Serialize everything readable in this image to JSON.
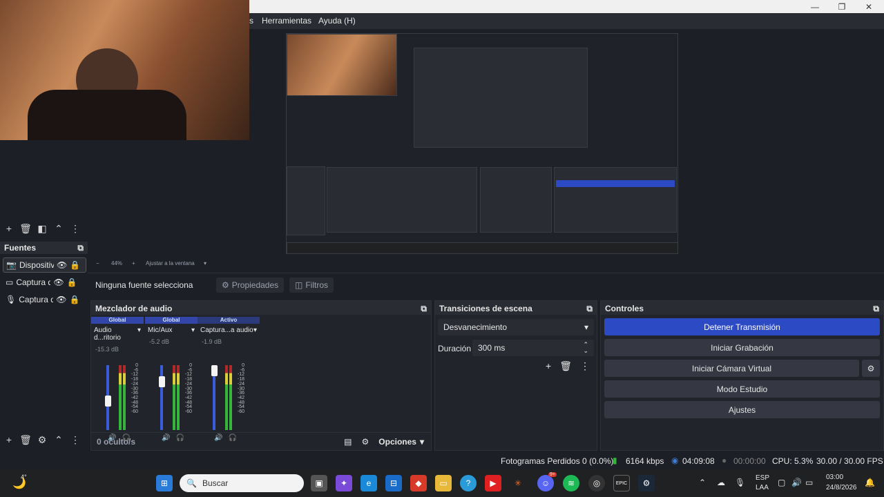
{
  "window": {
    "min": "—",
    "max": "❐",
    "close": "✕"
  },
  "menu": {
    "items": [
      "s",
      "Herramientas",
      "Ayuda (H)"
    ]
  },
  "sources": {
    "title": "Fuentes",
    "items": [
      {
        "label": "Dispositiv",
        "icon": "camera-icon"
      },
      {
        "label": "Captura d",
        "icon": "monitor-icon"
      },
      {
        "label": "Captura d",
        "icon": "mic-icon"
      }
    ]
  },
  "zoom": {
    "minus": "−",
    "value": "44%",
    "plus": "+",
    "fit": "Ajustar a la ventana"
  },
  "source_bar": {
    "none": "Ninguna fuente selecciona",
    "properties": "Propiedades",
    "filters": "Filtros"
  },
  "mixer": {
    "title": "Mezclador de audio",
    "channels": [
      {
        "tag": "Global",
        "name": "Audio d...ritorio",
        "db": "-15.3 dB",
        "level": 0.45
      },
      {
        "tag": "Global",
        "name": "Mic/Aux",
        "db": "-5.2 dB",
        "level": 0.75
      },
      {
        "tag": "Activo",
        "name": "Captura...a audio",
        "db": "-1.9 dB",
        "level": 0.92
      }
    ],
    "scale": [
      "0",
      "-6",
      "-12",
      "-18",
      "-24",
      "-30",
      "-36",
      "-42",
      "-48",
      "-54",
      "-60"
    ],
    "hidden": "0 oculto/s",
    "options": "Opciones"
  },
  "transitions": {
    "title": "Transiciones de escena",
    "selected": "Desvanecimiento",
    "duration_label": "Duración",
    "duration": "300 ms"
  },
  "controls": {
    "title": "Controles",
    "stream": "Detener Transmisión",
    "record": "Iniciar Grabación",
    "vcam": "Iniciar Cámara Virtual",
    "studio": "Modo Estudio",
    "settings": "Ajustes"
  },
  "status": {
    "dropped": "Fotogramas Perdidos 0 (0.0%)",
    "bitrate": "6164 kbps",
    "stream_time": "04:09:08",
    "rec_time": "00:00:00",
    "cpu": "CPU: 5.3%",
    "fps": "30.00 / 30.00 FPS"
  },
  "taskbar": {
    "temp": "4°",
    "search": "Buscar",
    "lang1": "ESP",
    "lang2": "LAA",
    "time": "03:00",
    "date": "24/8/2026",
    "discord_badge": "9+"
  },
  "colors": {
    "accent": "#2c4ac4",
    "bg": "#1d1f26",
    "panel": "#22242b"
  }
}
